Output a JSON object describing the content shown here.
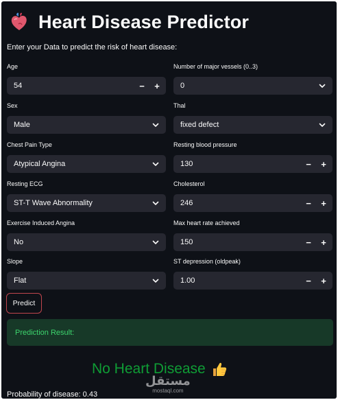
{
  "app": {
    "title": "Heart Disease Predictor",
    "title_icon": "anatomical-heart-icon",
    "subtitle": "Enter your Data to predict the risk of heart disease:"
  },
  "form": {
    "age": {
      "label": "Age",
      "value": "54",
      "type": "number-stepper"
    },
    "vessels": {
      "label": "Number of major vessels (0..3)",
      "value": "0",
      "type": "select"
    },
    "sex": {
      "label": "Sex",
      "value": "Male",
      "type": "select"
    },
    "thal": {
      "label": "Thal",
      "value": "fixed defect",
      "type": "select"
    },
    "chest_pain": {
      "label": "Chest Pain Type",
      "value": "Atypical Angina",
      "type": "select"
    },
    "resting_bp": {
      "label": "Resting blood pressure",
      "value": "130",
      "type": "number-stepper"
    },
    "resting_ecg": {
      "label": "Resting ECG",
      "value": "ST-T Wave Abnormality",
      "type": "select"
    },
    "cholesterol": {
      "label": "Cholesterol",
      "value": "246",
      "type": "number-stepper"
    },
    "exercise_angina": {
      "label": "Exercise Induced Angina",
      "value": "No",
      "type": "select"
    },
    "max_hr": {
      "label": "Max heart rate achieved",
      "value": "150",
      "type": "number-stepper"
    },
    "slope": {
      "label": "Slope",
      "value": "Flat",
      "type": "select"
    },
    "oldpeak": {
      "label": "ST depression (oldpeak)",
      "value": "1.00",
      "type": "number-stepper"
    },
    "stepper_minus": "−",
    "stepper_plus": "+"
  },
  "actions": {
    "predict_label": "Predict"
  },
  "result": {
    "header": "Prediction Result:",
    "verdict": "No Heart Disease",
    "verdict_icon": "thumbs-up-icon",
    "probability_text": "Probability of disease: 0.43"
  },
  "watermark": {
    "arabic": "مستقل",
    "latin": "mostaql.com"
  },
  "colors": {
    "background": "#0e1117",
    "input_bg": "#262730",
    "text": "#fafafa",
    "success_bg": "#173928",
    "success_text": "#3dd56d",
    "verdict_text": "#0f9d35",
    "button_border": "#c1464e"
  }
}
